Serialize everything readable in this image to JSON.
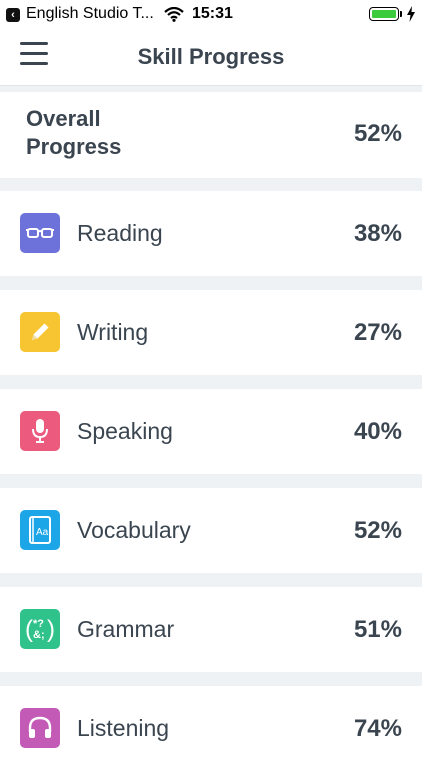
{
  "status_bar": {
    "back_app": "English Studio T...",
    "time": "15:31"
  },
  "nav": {
    "title": "Skill Progress"
  },
  "overall": {
    "label": "Overall Progress",
    "percent": "52%"
  },
  "skills": [
    {
      "label": "Reading",
      "percent": "38%",
      "icon": "glasses-icon",
      "color": "#6c72d9"
    },
    {
      "label": "Writing",
      "percent": "27%",
      "icon": "pencil-icon",
      "color": "#f7c531"
    },
    {
      "label": "Speaking",
      "percent": "40%",
      "icon": "microphone-icon",
      "color": "#ec5a7e"
    },
    {
      "label": "Vocabulary",
      "percent": "52%",
      "icon": "book-icon",
      "color": "#1da6e7"
    },
    {
      "label": "Grammar",
      "percent": "51%",
      "icon": "grammar-icon",
      "color": "#2fc28a"
    },
    {
      "label": "Listening",
      "percent": "74%",
      "icon": "headphones-icon",
      "color": "#c25ab6"
    }
  ]
}
